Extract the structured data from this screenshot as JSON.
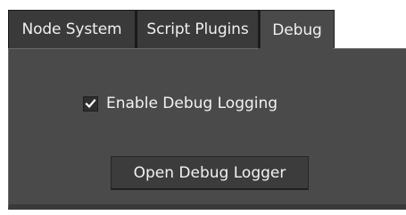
{
  "tabs": [
    {
      "label": "Node System",
      "active": false
    },
    {
      "label": "Script Plugins",
      "active": false
    },
    {
      "label": "Debug",
      "active": true
    }
  ],
  "debug": {
    "enable_logging": {
      "label": "Enable Debug Logging",
      "checked": true
    },
    "open_logger_label": "Open Debug Logger"
  },
  "colors": {
    "panel_bg": "#4a4a4a",
    "tab_bg": "#3a3a3a",
    "text": "#f2f2f2"
  },
  "icons": {
    "check": "checkmark-icon"
  }
}
